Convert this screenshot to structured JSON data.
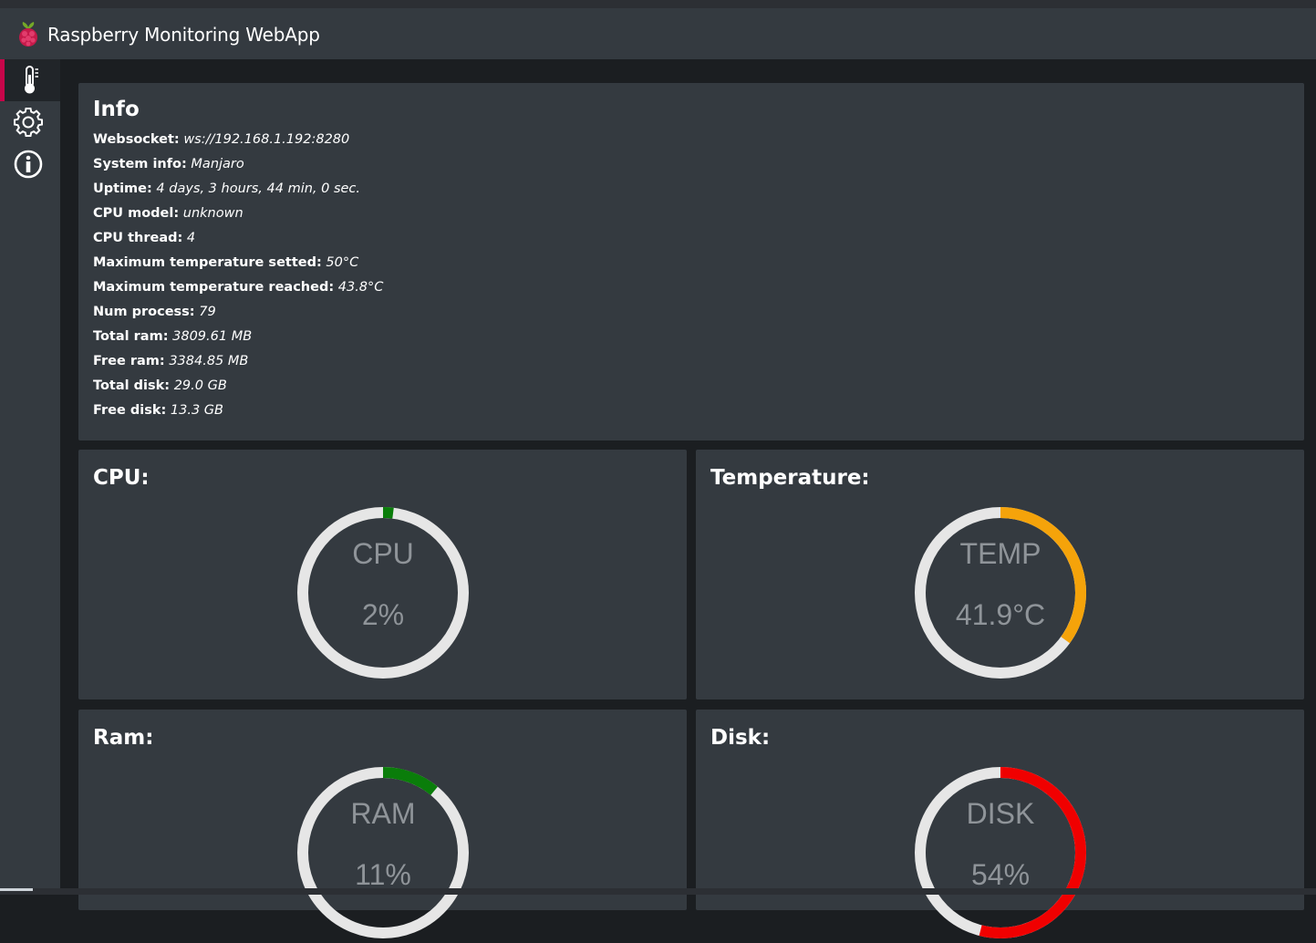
{
  "app": {
    "title": "Raspberry Monitoring WebApp",
    "logo_icon": "raspberry-icon"
  },
  "sidebar": {
    "items": [
      {
        "name": "monitor",
        "icon": "thermometer-icon",
        "active": true
      },
      {
        "name": "settings",
        "icon": "gear-icon",
        "active": false
      },
      {
        "name": "info",
        "icon": "info-icon",
        "active": false
      }
    ],
    "accent_color": "#c7064a"
  },
  "info": {
    "title": "Info",
    "rows": [
      {
        "key": "Websocket:",
        "value": "ws://192.168.1.192:8280"
      },
      {
        "key": "System info:",
        "value": "Manjaro"
      },
      {
        "key": "Uptime:",
        "value": "4 days, 3 hours, 44 min, 0 sec."
      },
      {
        "key": "CPU model:",
        "value": "unknown"
      },
      {
        "key": "CPU thread:",
        "value": "4"
      },
      {
        "key": "Maximum temperature setted:",
        "value": "50°C"
      },
      {
        "key": "Maximum temperature reached:",
        "value": "43.8°C"
      },
      {
        "key": "Num process:",
        "value": "79"
      },
      {
        "key": "Total ram:",
        "value": "3809.61 MB"
      },
      {
        "key": "Free ram:",
        "value": "3384.85 MB"
      },
      {
        "key": "Total disk:",
        "value": "29.0 GB"
      },
      {
        "key": "Free disk:",
        "value": "13.3 GB"
      }
    ]
  },
  "gauges": {
    "cpu": {
      "heading": "CPU:",
      "label": "CPU",
      "value_text": "2%",
      "fraction": 0.02,
      "color": "#0a7d0a"
    },
    "temp": {
      "heading": "Temperature:",
      "label": "TEMP",
      "value_text": "41.9°C",
      "fraction": 0.35,
      "color": "#f5a30a"
    },
    "ram": {
      "heading": "Ram:",
      "label": "RAM",
      "value_text": "11%",
      "fraction": 0.11,
      "color": "#0a7d0a"
    },
    "disk": {
      "heading": "Disk:",
      "label": "DISK",
      "value_text": "54%",
      "fraction": 0.54,
      "color": "#f00000"
    }
  },
  "colors": {
    "gauge_track": "#e6e6e6",
    "card_bg": "#343a40",
    "page_bg": "#1b1e21"
  }
}
